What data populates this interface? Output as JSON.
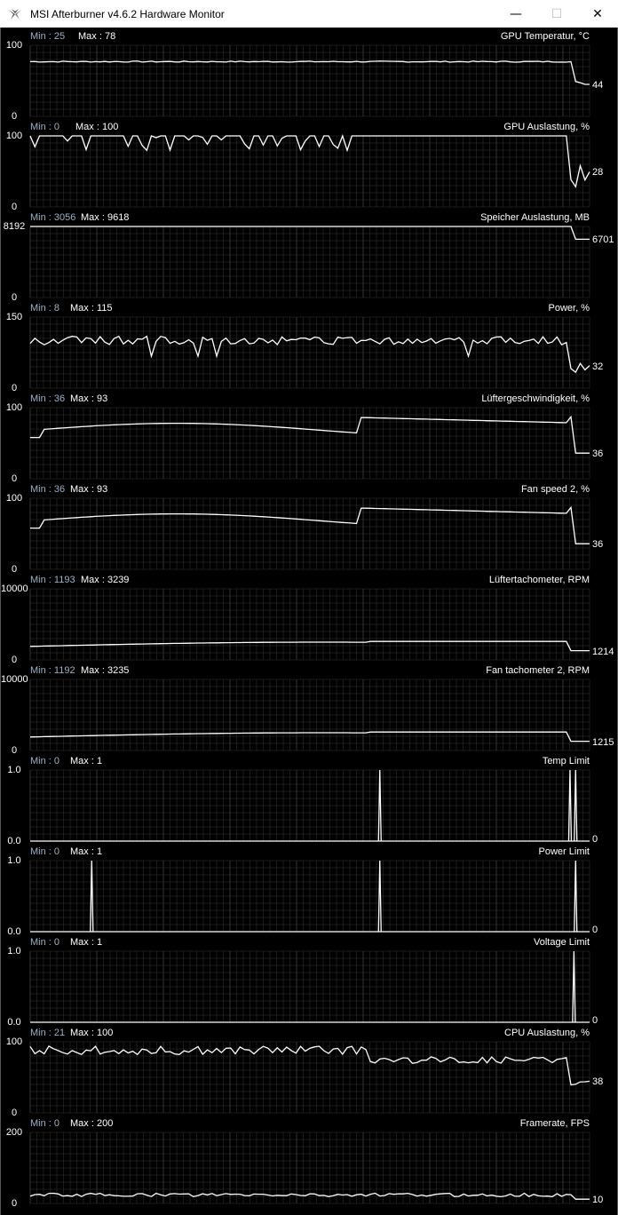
{
  "window": {
    "title": "MSI Afterburner v4.6.2 Hardware Monitor",
    "minimize_glyph": "—",
    "maximize_glyph": "☐",
    "close_glyph": "✕",
    "app_icon": "afterburner-logo-icon"
  },
  "labels": {
    "min_prefix": "Min : ",
    "max_prefix": "Max : "
  },
  "colors": {
    "background": "#000000",
    "grid": "#3a3a3a",
    "line": "#ffffff",
    "min_text": "#9bb0c4"
  },
  "graphs": [
    {
      "title": "GPU Temperatur, °C",
      "min": "25",
      "max": "78",
      "y_top": "100",
      "y_bottom": "0",
      "current": "44"
    },
    {
      "title": "GPU Auslastung, %",
      "min": "0",
      "max": "100",
      "y_top": "100",
      "y_bottom": "0",
      "current": "28"
    },
    {
      "title": "Speicher Auslastung, MB",
      "min": "3056",
      "max": "9618",
      "y_top": "8192",
      "y_bottom": "0",
      "current": "6701"
    },
    {
      "title": "Power, %",
      "min": "8",
      "max": "115",
      "y_top": "150",
      "y_bottom": "0",
      "current": "32"
    },
    {
      "title": "Lüftergeschwindigkeit, %",
      "min": "36",
      "max": "93",
      "y_top": "100",
      "y_bottom": "0",
      "current": "36"
    },
    {
      "title": "Fan speed 2, %",
      "min": "36",
      "max": "93",
      "y_top": "100",
      "y_bottom": "0",
      "current": "36"
    },
    {
      "title": "Lüftertachometer, RPM",
      "min": "1193",
      "max": "3239",
      "y_top": "10000",
      "y_bottom": "0",
      "current": "1214"
    },
    {
      "title": "Fan tachometer 2, RPM",
      "min": "1192",
      "max": "3235",
      "y_top": "10000",
      "y_bottom": "0",
      "current": "1215"
    },
    {
      "title": "Temp Limit",
      "min": "0",
      "max": "1",
      "y_top": "1.0",
      "y_bottom": "0.0",
      "current": "0"
    },
    {
      "title": "Power Limit",
      "min": "0",
      "max": "1",
      "y_top": "1.0",
      "y_bottom": "0.0",
      "current": "0"
    },
    {
      "title": "Voltage Limit",
      "min": "0",
      "max": "1",
      "y_top": "1.0",
      "y_bottom": "0.0",
      "current": "0"
    },
    {
      "title": "CPU Auslastung, %",
      "min": "21",
      "max": "100",
      "y_top": "100",
      "y_bottom": "0",
      "current": "38"
    },
    {
      "title": "Framerate, FPS",
      "min": "0",
      "max": "200",
      "y_top": "200",
      "y_bottom": "0",
      "current": "10"
    }
  ]
}
